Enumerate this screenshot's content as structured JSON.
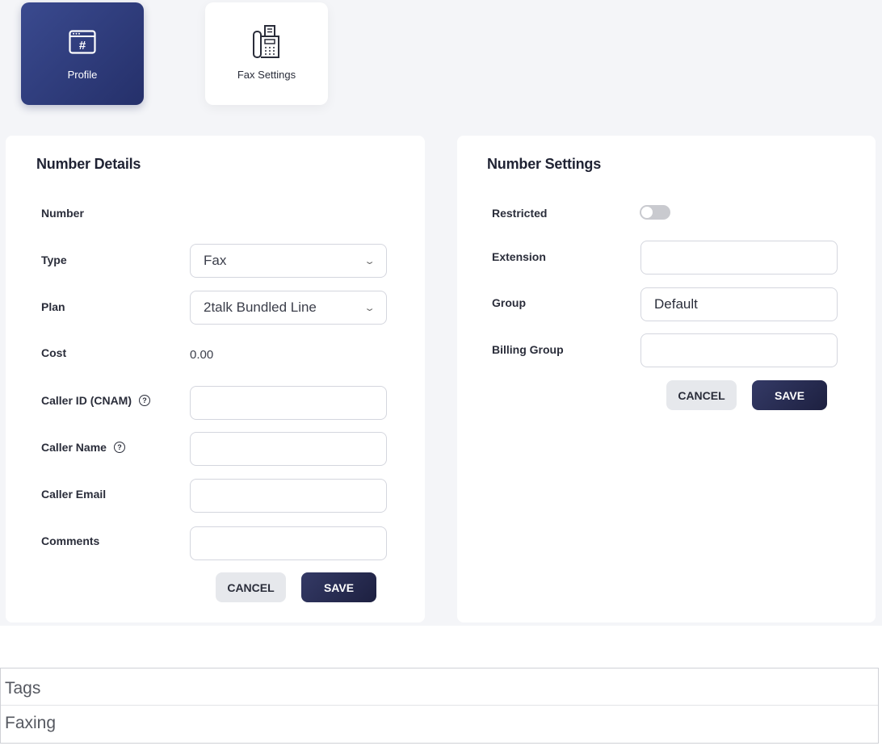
{
  "tabs": [
    {
      "label": "Profile",
      "icon": "browser-hash-icon",
      "active": true
    },
    {
      "label": "Fax Settings",
      "icon": "fax-machine-icon",
      "active": false
    }
  ],
  "number_details": {
    "title": "Number Details",
    "number_label": "Number",
    "type_label": "Type",
    "type_value": "Fax",
    "plan_label": "Plan",
    "plan_value": "2talk Bundled Line",
    "cost_label": "Cost",
    "cost_value": "0.00",
    "caller_id_label": "Caller ID (CNAM)",
    "caller_id_value": "",
    "caller_name_label": "Caller Name",
    "caller_name_value": "",
    "caller_email_label": "Caller Email",
    "caller_email_value": "",
    "comments_label": "Comments",
    "comments_value": "",
    "cancel_label": "CANCEL",
    "save_label": "SAVE"
  },
  "number_settings": {
    "title": "Number Settings",
    "restricted_label": "Restricted",
    "restricted_on": false,
    "extension_label": "Extension",
    "extension_value": "",
    "group_label": "Group",
    "group_value": "Default",
    "billing_group_label": "Billing Group",
    "billing_group_value": "",
    "cancel_label": "CANCEL",
    "save_label": "SAVE"
  },
  "tags": {
    "title": "Tags",
    "items": [
      "Faxing"
    ]
  },
  "help_glyph": "?"
}
